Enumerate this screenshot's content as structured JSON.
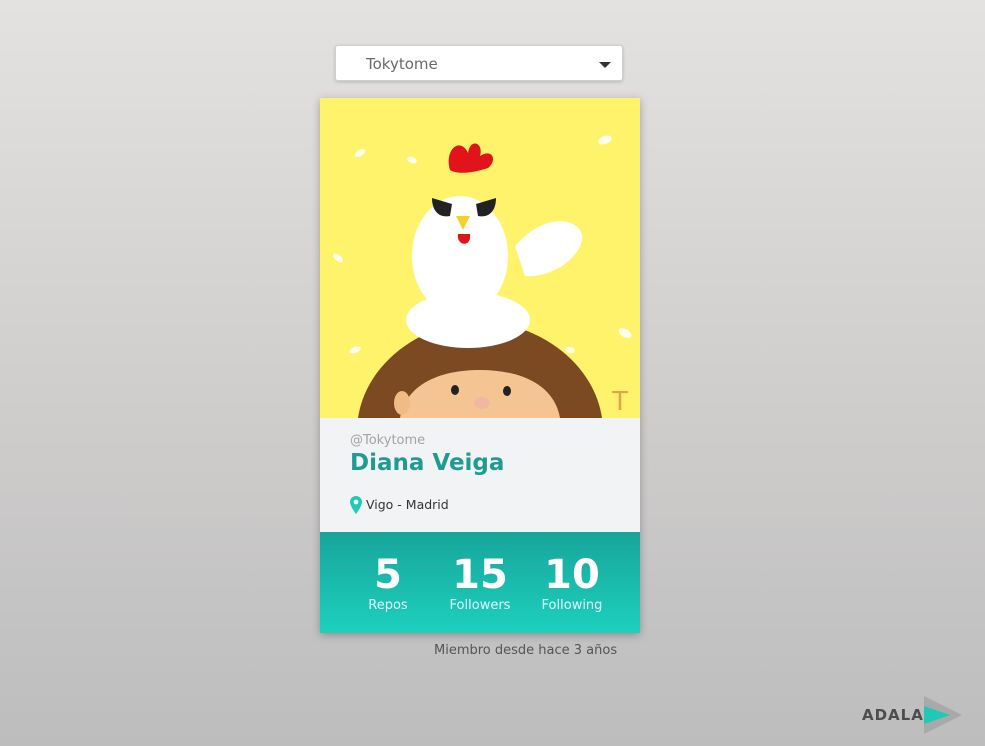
{
  "user_select": {
    "selected": "Tokytome"
  },
  "profile": {
    "username": "@Tokytome",
    "name": "Diana Veiga",
    "location": "Vigo - Madrid"
  },
  "stats": [
    {
      "value": "5",
      "label": "Repos"
    },
    {
      "value": "15",
      "label": "Followers"
    },
    {
      "value": "10",
      "label": "Following"
    }
  ],
  "member_since": "Miembro desde hace 3 años",
  "logo": {
    "text": "ADALAB"
  },
  "colors": {
    "accent": "#1e9c93",
    "stats_gradient_top": "#17a59a",
    "stats_gradient_bottom": "#1dd0be",
    "avatar_background": "#fff36b"
  },
  "icons": {
    "dropdown": "chevron-down-icon",
    "location": "map-pin-icon"
  }
}
